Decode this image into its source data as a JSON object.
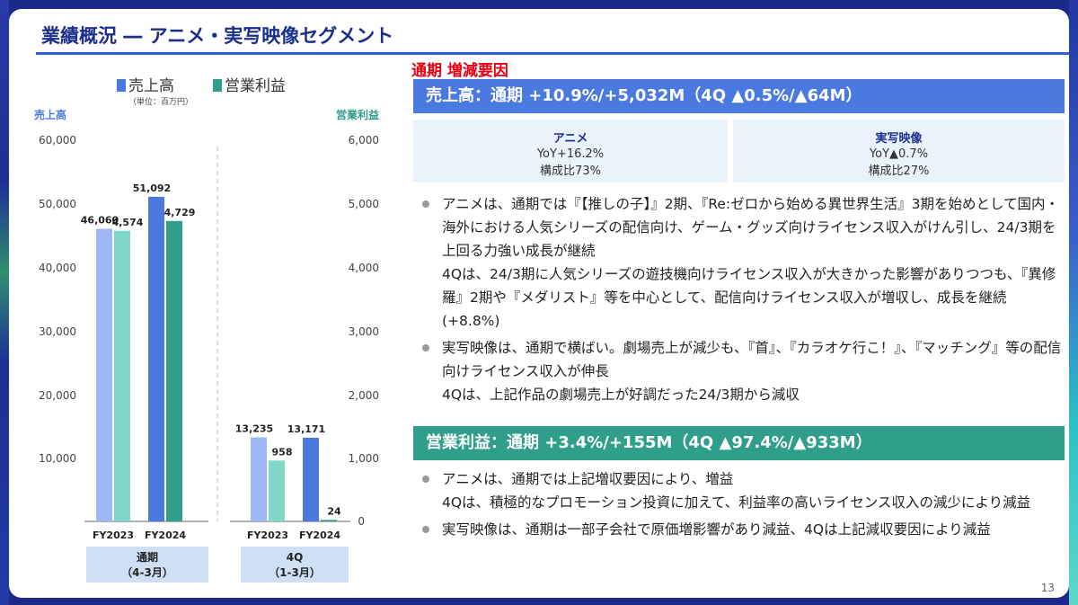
{
  "title": "業績概況 ― アニメ・実写映像セグメント",
  "legend": {
    "sales": "売上高",
    "profit": "営業利益",
    "unit": "（単位：百万円）"
  },
  "axis": {
    "left_title": "売上高",
    "right_title": "営業利益",
    "left_ticks": [
      "60,000",
      "50,000",
      "40,000",
      "30,000",
      "20,000",
      "10,000"
    ],
    "right_ticks": [
      "6,000",
      "5,000",
      "4,000",
      "3,000",
      "2,000",
      "1,000",
      "0"
    ]
  },
  "groups": [
    {
      "name": "通期",
      "period": "（4-3月）"
    },
    {
      "name": "4Q",
      "period": "（1-3月）"
    }
  ],
  "chart_data": {
    "type": "bar",
    "categories": [
      "FY2023",
      "FY2024",
      "FY2023",
      "FY2024"
    ],
    "series": [
      {
        "name": "売上高",
        "axis": "left",
        "values": [
          46060,
          51092,
          13235,
          13171
        ],
        "labels": [
          "46,060",
          "51,092",
          "13,235",
          "13,171"
        ],
        "colors": [
          "#9db8f5",
          "#4a79e0",
          "#9db8f5",
          "#4a79e0"
        ]
      },
      {
        "name": "営業利益",
        "axis": "right",
        "values": [
          4574,
          4729,
          958,
          24
        ],
        "labels": [
          "4,574",
          "4,729",
          "958",
          "24"
        ],
        "colors": [
          "#7fd8c9",
          "#2f9e8a",
          "#7fd8c9",
          "#2f9e8a"
        ]
      }
    ],
    "ylim_left": [
      0,
      60000
    ],
    "ylim_right": [
      0,
      6000
    ]
  },
  "reasons_title": "通期 増減要因",
  "sales_banner": "売上高：通期 +10.9%/+5,032M（4Q ▲0.5%/▲64M）",
  "segments": [
    {
      "name": "アニメ",
      "yoy": "YoY+16.2%",
      "ratio": "構成比73%"
    },
    {
      "name": "実写映像",
      "yoy": "YoY▲0.7%",
      "ratio": "構成比27%"
    }
  ],
  "sales_bullets": [
    {
      "l1": "アニメは、通期では『【推しの子】』2期、『Re:ゼロから始める異世界生活』3期を始めとして国内・海外における人気シリーズの配信向け、ゲーム・グッズ向けライセンス収入がけん引し、24/3期を上回る力強い成長が継続",
      "l2": "4Qは、24/3期に人気シリーズの遊技機向けライセンス収入が大きかった影響がありつつも、『異修羅』2期や『メダリスト』等を中心として、配信向けライセンス収入が増収し、成長を継続(+8.8%)"
    },
    {
      "l1": "実写映像は、通期で横ばい。劇場売上が減少も、『首』、『カラオケ行こ！』、『マッチング』等の配信向けライセンス収入が伸長",
      "l2": "4Qは、上記作品の劇場売上が好調だった24/3期から減収"
    }
  ],
  "profit_banner": "営業利益：通期 +3.4%/+155M（4Q ▲97.4%/▲933M）",
  "profit_bullets": [
    {
      "l1": "アニメは、通期では上記増収要因により、増益",
      "l2": "4Qは、積極的なプロモーション投資に加えて、利益率の高いライセンス収入の減少により減益"
    },
    {
      "l1": "実写映像は、通期は一部子会社で原価増影響があり減益、4Qは上記減収要因により減益",
      "l2": ""
    }
  ],
  "page_number": "13"
}
